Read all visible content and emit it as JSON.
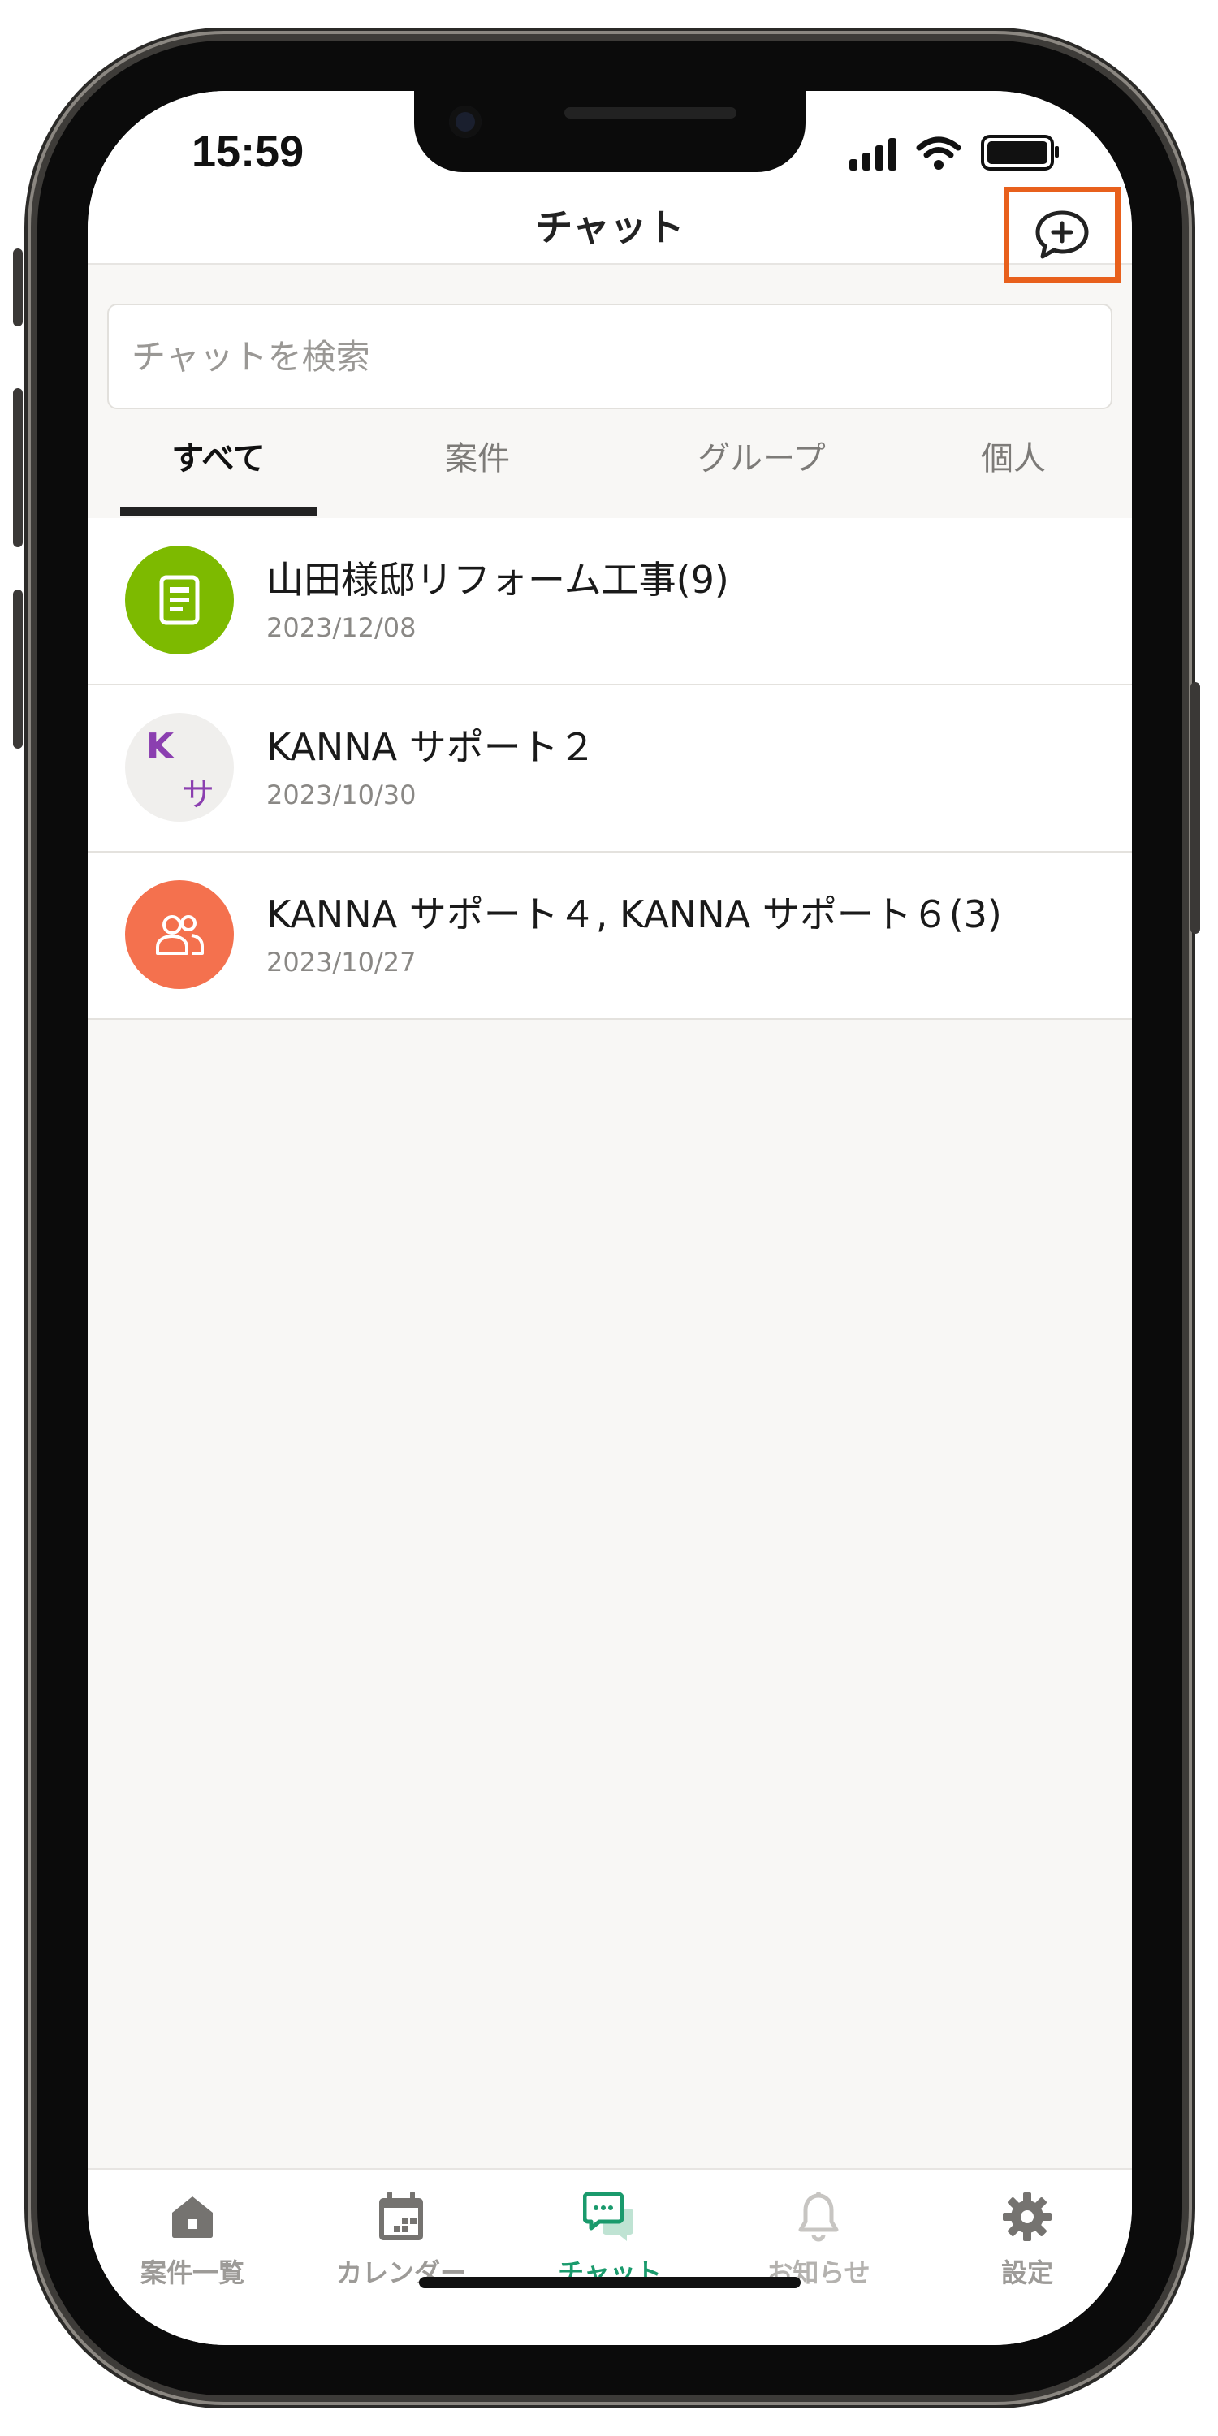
{
  "status_bar": {
    "time": "15:59"
  },
  "header": {
    "title": "チャット",
    "new_chat_icon": "chat-plus-icon"
  },
  "search": {
    "placeholder": "チャットを検索"
  },
  "filter_tabs": [
    {
      "label": "すべて",
      "active": true
    },
    {
      "label": "案件",
      "active": false
    },
    {
      "label": "グループ",
      "active": false
    },
    {
      "label": "個人",
      "active": false
    }
  ],
  "chats": [
    {
      "title": "山田様邸リフォーム工事(9)",
      "date": "2023/12/08",
      "avatar_icon": "document-icon",
      "avatar_color": "#7dba00"
    },
    {
      "title": "KANNA サポート２",
      "date": "2023/10/30",
      "avatar_initials": [
        "K",
        "サ"
      ],
      "avatar_color": "#8b3fb0"
    },
    {
      "title": "KANNA サポート４, KANNA サポート６(3)",
      "date": "2023/10/27",
      "avatar_icon": "group-icon",
      "avatar_color": "#f4714e"
    }
  ],
  "tab_bar": [
    {
      "label": "案件一覧",
      "icon": "home-icon",
      "active": false
    },
    {
      "label": "カレンダー",
      "icon": "calendar-icon",
      "active": false
    },
    {
      "label": "チャット",
      "icon": "chat-icon",
      "active": true
    },
    {
      "label": "お知らせ",
      "icon": "bell-icon",
      "active": false
    },
    {
      "label": "設定",
      "icon": "gear-icon",
      "active": false
    }
  ],
  "colors": {
    "accent": "#1a9a6c",
    "highlight_box": "#e8601c"
  }
}
